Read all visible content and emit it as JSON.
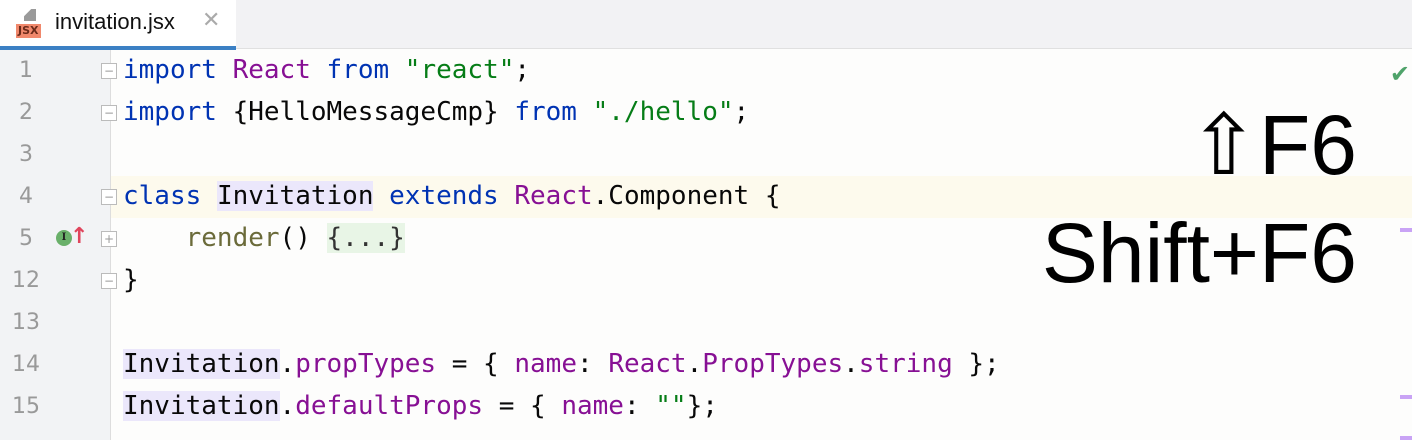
{
  "tab": {
    "icon_label": "JSX",
    "file_name": "invitation.jsx",
    "close": "✕"
  },
  "lines": [
    {
      "n": "1",
      "t": [
        [
          "kw",
          "import"
        ],
        [
          "",
          "  "
        ],
        [
          "pur",
          "React"
        ],
        [
          "",
          " "
        ],
        [
          "kw",
          "from"
        ],
        [
          "",
          " "
        ],
        [
          "str",
          "\"react\""
        ],
        [
          "",
          ";"
        ]
      ]
    },
    {
      "n": "2"
    },
    {
      "n": "3"
    },
    {
      "n": "4"
    },
    {
      "n": "5"
    },
    {
      "n": "12"
    },
    {
      "n": "13"
    },
    {
      "n": "14"
    },
    {
      "n": "15"
    }
  ],
  "code": {
    "l1": {
      "a": "import",
      "b": "React",
      "c": "from",
      "d": "\"react\"",
      "e": ";"
    },
    "l2": {
      "a": "import",
      "b": "{HelloMessageCmp}",
      "c": "from",
      "d": "\"./hello\"",
      "e": ";"
    },
    "l4": {
      "a": "class",
      "b": "Invitation",
      "c": "extends",
      "d": "React",
      "e": ".Component {"
    },
    "l5": {
      "a": "render",
      "b": "() ",
      "c": "{...}"
    },
    "l12": "}",
    "l14": {
      "a": "Invitation",
      "b": ".",
      "c": "propTypes",
      "d": " = { ",
      "e": "name",
      "f": ": ",
      "g": "React",
      "h": ".",
      "i": "PropTypes",
      "j": ".",
      "k": "string",
      "l": " };"
    },
    "l15": {
      "a": "Invitation",
      "b": ".",
      "c": "defaultProps",
      "d": " = { ",
      "e": "name",
      "f": ": ",
      "g": "\"\"",
      "h": "};"
    }
  },
  "gutter_icon": "I",
  "overlay": {
    "mac": "⇧F6",
    "win": "Shift+F6"
  },
  "colors": {
    "keyword": "#0033b3",
    "string": "#067d17",
    "field": "#871094",
    "accent": "#3b80c4"
  }
}
